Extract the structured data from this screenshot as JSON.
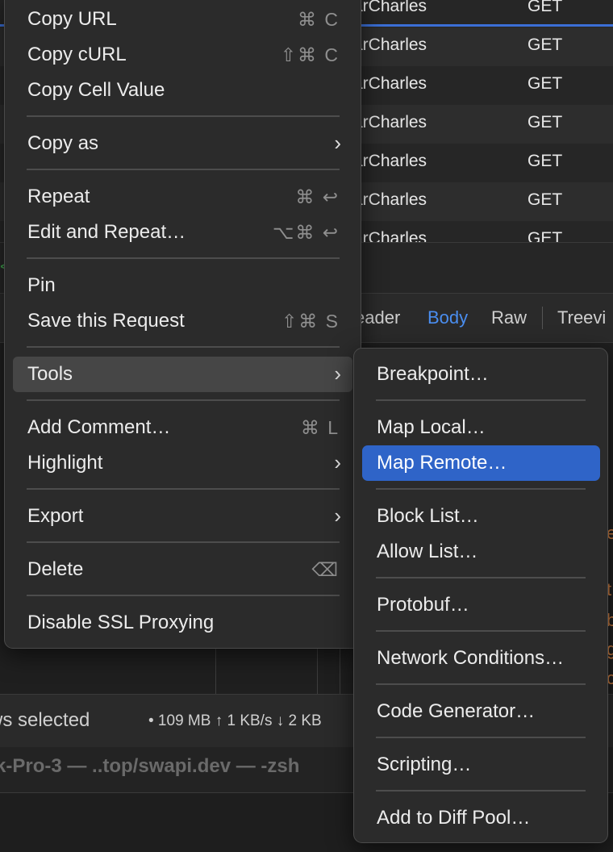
{
  "background": {
    "requests": [
      {
        "client": "arCharles",
        "method": "GET"
      },
      {
        "client": "arCharles",
        "method": "GET"
      },
      {
        "client": "arCharles",
        "method": "GET"
      },
      {
        "client": "arCharles",
        "method": "GET"
      },
      {
        "client": "arCharles",
        "method": "GET"
      },
      {
        "client": "arCharles",
        "method": "GET"
      },
      {
        "client": "arCharles",
        "method": "GET"
      }
    ],
    "tabs": {
      "header": "eader",
      "body": "Body",
      "raw": "Raw",
      "treeview": "Treevi"
    },
    "status_left": "ws selected",
    "status_stats": "• 109 MB ↑ 1 KB/s ↓ 2 KB",
    "terminal_title": "k-Pro-3 — ..top/swapi.dev — -zsh",
    "edge_chars": [
      "e",
      "t",
      "b",
      "g",
      "c"
    ],
    "accent_color": "#2f64c8"
  },
  "menu": {
    "copy_url": {
      "label": "Copy URL",
      "shortcut": "⌘ C"
    },
    "copy_curl": {
      "label": "Copy cURL",
      "shortcut": "⇧⌘ C"
    },
    "copy_cell": {
      "label": "Copy Cell Value"
    },
    "copy_as": {
      "label": "Copy as"
    },
    "repeat": {
      "label": "Repeat",
      "shortcut": "⌘ ↩"
    },
    "edit_repeat": {
      "label": "Edit and Repeat…",
      "shortcut": "⌥⌘ ↩"
    },
    "pin": {
      "label": "Pin"
    },
    "save_request": {
      "label": "Save this Request",
      "shortcut": "⇧⌘ S"
    },
    "tools": {
      "label": "Tools"
    },
    "add_comment": {
      "label": "Add Comment…",
      "shortcut": "⌘ L"
    },
    "highlight": {
      "label": "Highlight"
    },
    "export": {
      "label": "Export"
    },
    "delete": {
      "label": "Delete",
      "shortcut": "⌫"
    },
    "disable_ssl": {
      "label": "Disable SSL Proxying"
    }
  },
  "submenu": {
    "breakpoint": "Breakpoint…",
    "map_local": "Map Local…",
    "map_remote": "Map Remote…",
    "block_list": "Block List…",
    "allow_list": "Allow List…",
    "protobuf": "Protobuf…",
    "network_conditions": "Network Conditions…",
    "code_generator": "Code Generator…",
    "scripting": "Scripting…",
    "add_diff_pool": "Add to Diff Pool…"
  }
}
